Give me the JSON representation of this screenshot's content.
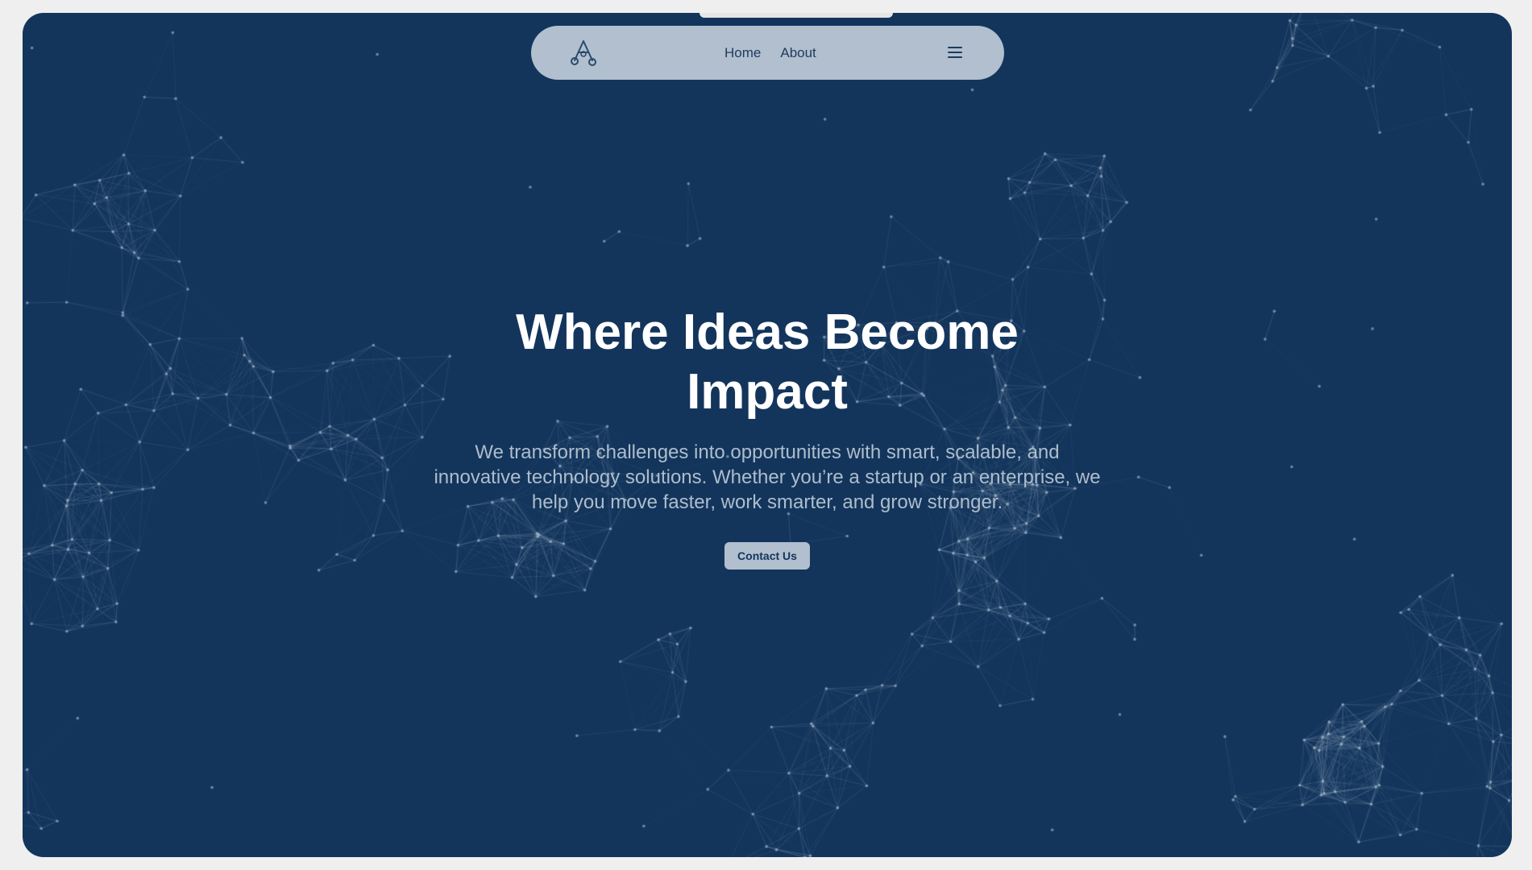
{
  "theme": {
    "background": "#13355c",
    "nav_background": "#b1bfce",
    "text_primary": "#ffffff",
    "text_secondary": "#aebdcc",
    "nav_text": "#1e3a5f"
  },
  "navbar": {
    "logo_icon": "abstract-a-logo-icon",
    "links": [
      {
        "label": "Home"
      },
      {
        "label": "About"
      }
    ],
    "menu_icon": "hamburger-menu-icon"
  },
  "hero": {
    "title": "Where Ideas Become Impact",
    "subtitle": "We transform challenges into opportunities with smart, scalable, and innovative technology solutions. Whether you’re a startup or an enterprise, we help you move faster, work smarter, and grow stronger.",
    "cta_label": "Contact Us"
  },
  "background": {
    "pattern": "particle-network"
  }
}
